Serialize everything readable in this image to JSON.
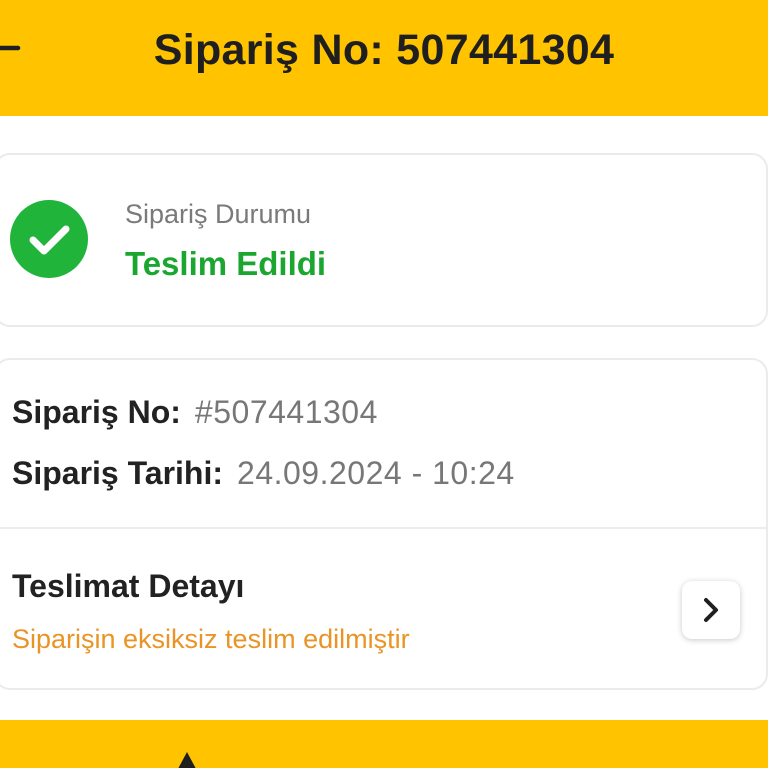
{
  "header": {
    "title": "Sipariş No: 507441304",
    "back_icon": "back-arrow-icon"
  },
  "status_card": {
    "label": "Sipariş Durumu",
    "value": "Teslim Edildi",
    "icon": "check-circle-icon",
    "status_color": "#1BA630"
  },
  "order_info": {
    "order_no_label": "Sipariş No:",
    "order_no_value": "#507441304",
    "date_label": "Sipariş Tarihi:",
    "date_value": "24.09.2024 - 10:24"
  },
  "delivery": {
    "title": "Teslimat Detayı",
    "message": "Siparişin eksiksiz teslim edilmiştir",
    "message_color": "#E99424",
    "icon": "chevron-right-icon"
  },
  "bottom_bar": {
    "accent_color": "#FFC300",
    "icon": "warning-icon"
  }
}
